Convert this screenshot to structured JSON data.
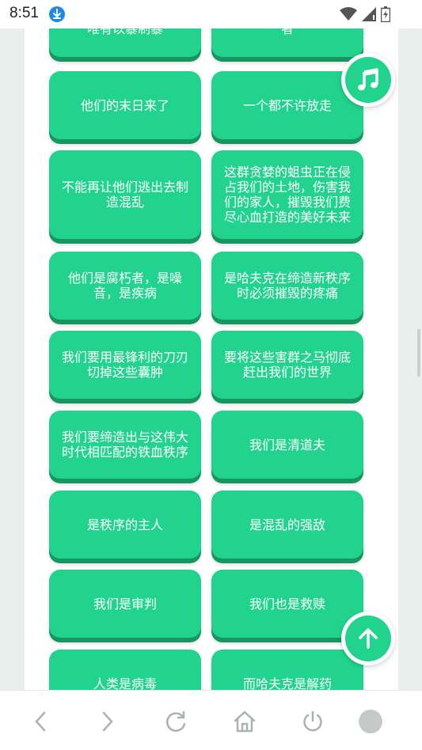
{
  "status_bar": {
    "time": "8:51",
    "icons": [
      "download-icon",
      "wifi-icon",
      "signal-icon",
      "battery-icon"
    ]
  },
  "cards": [
    {
      "text": "唯有以暴制暴"
    },
    {
      "text": "者"
    },
    {
      "text": "他们的末日来了"
    },
    {
      "text": "一个都不许放走"
    },
    {
      "text": "不能再让他们逃出去制造混乱"
    },
    {
      "text": "这群贪婪的蛆虫正在侵占我们的土地，伤害我们的家人，摧毁我们费尽心血打造的美好未来"
    },
    {
      "text": "他们是腐朽者，是噪音，是疾病"
    },
    {
      "text": "是哈夫克在缔造新秩序时必须摧毁的疼痛"
    },
    {
      "text": "我们要用最锋利的刀刃切掉这些囊肿"
    },
    {
      "text": "要将这些害群之马彻底赶出我们的世界"
    },
    {
      "text": "我们要缔造出与这伟大时代相匹配的铁血秩序"
    },
    {
      "text": "我们是清道夫"
    },
    {
      "text": "是秩序的主人"
    },
    {
      "text": "是混乱的强敌"
    },
    {
      "text": "我们是审判"
    },
    {
      "text": "我们也是救赎"
    },
    {
      "text": "人类是病毒"
    },
    {
      "text": "而哈夫克是解药"
    }
  ],
  "floating_buttons": {
    "music_icon": "music-note-icon",
    "top_icon": "arrow-up-icon"
  },
  "nav_bar": {
    "icons": [
      "back-icon",
      "forward-icon",
      "refresh-icon",
      "home-icon",
      "power-icon",
      "tabs-icon"
    ]
  },
  "colors": {
    "card": "#21d38d",
    "card_shadow": "#179662",
    "background": "#e9efed"
  }
}
